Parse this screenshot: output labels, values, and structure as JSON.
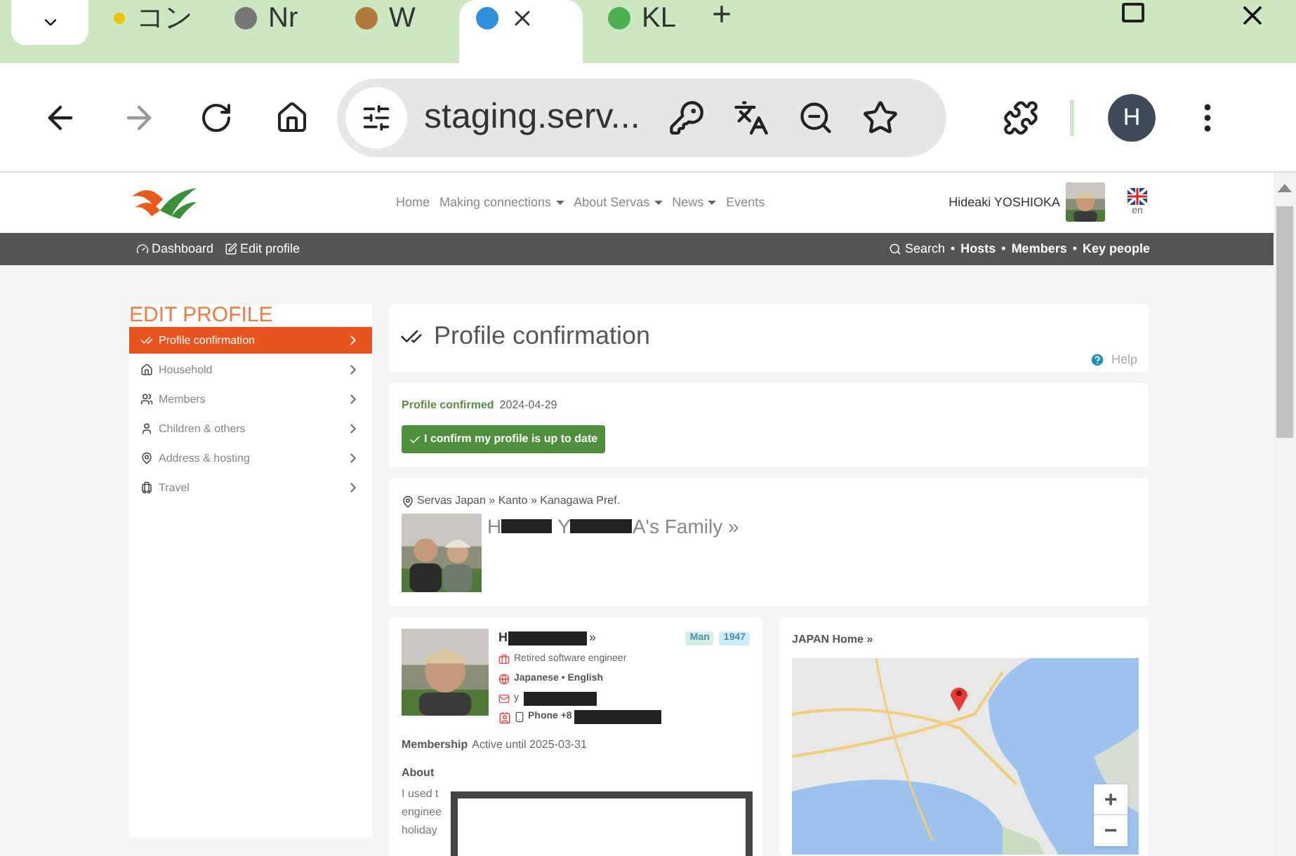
{
  "browser": {
    "tabs": [
      {
        "label": "コン",
        "selected": false
      },
      {
        "label": "Nr",
        "selected": false
      },
      {
        "label": "W",
        "selected": false
      },
      {
        "selected": true
      },
      {
        "label": "KL",
        "selected": false
      }
    ],
    "new_tab": "+",
    "url": "staging.serv...",
    "profile_letter": "H"
  },
  "header": {
    "nav": [
      {
        "label": "Home",
        "dropdown": false
      },
      {
        "label": "Making connections",
        "dropdown": true
      },
      {
        "label": "About Servas",
        "dropdown": true
      },
      {
        "label": "News",
        "dropdown": true
      },
      {
        "label": "Events",
        "dropdown": false
      }
    ],
    "user": "Hideaki YOSHIOKA",
    "language": "en"
  },
  "subnav": {
    "left": [
      "Dashboard",
      "Edit profile"
    ],
    "search": "Search",
    "separator": "•",
    "links": [
      "Hosts",
      "Members",
      "Key people"
    ]
  },
  "sidebar": {
    "title": "EDIT PROFILE",
    "items": [
      {
        "label": "Profile confirmation",
        "selected": true
      },
      {
        "label": "Household",
        "selected": false
      },
      {
        "label": "Members",
        "selected": false
      },
      {
        "label": "Children & others",
        "selected": false
      },
      {
        "label": "Address & hosting",
        "selected": false
      },
      {
        "label": "Travel",
        "selected": false
      }
    ]
  },
  "main": {
    "title": "Profile confirmation",
    "help": "Help",
    "confirmed_label": "Profile confirmed",
    "confirmed_date": "2024-04-29",
    "confirm_button": "I confirm my profile is up to date",
    "location": "Servas Japan » Kanto » Kanagawa Pref.",
    "family_parts": [
      "H",
      "Y",
      "A's Family »"
    ],
    "profile": {
      "name_start": "H",
      "name_end": "»",
      "badges": [
        {
          "label": "Man",
          "color": "#d5efe3"
        },
        {
          "label": "1947",
          "color": "#cdeefa"
        }
      ],
      "job": "Retired software engineer",
      "languages": "Japanese • English",
      "email_start": "y",
      "phone_start": "Phone +8",
      "membership_label": "Membership",
      "membership_value": "Active until 2025-03-31",
      "about_title": "About",
      "about_lines": [
        "I used t",
        "enginee",
        "holiday"
      ]
    },
    "map": {
      "title": "JAPAN Home »",
      "zoom_in": "+",
      "zoom_out": "−"
    }
  }
}
